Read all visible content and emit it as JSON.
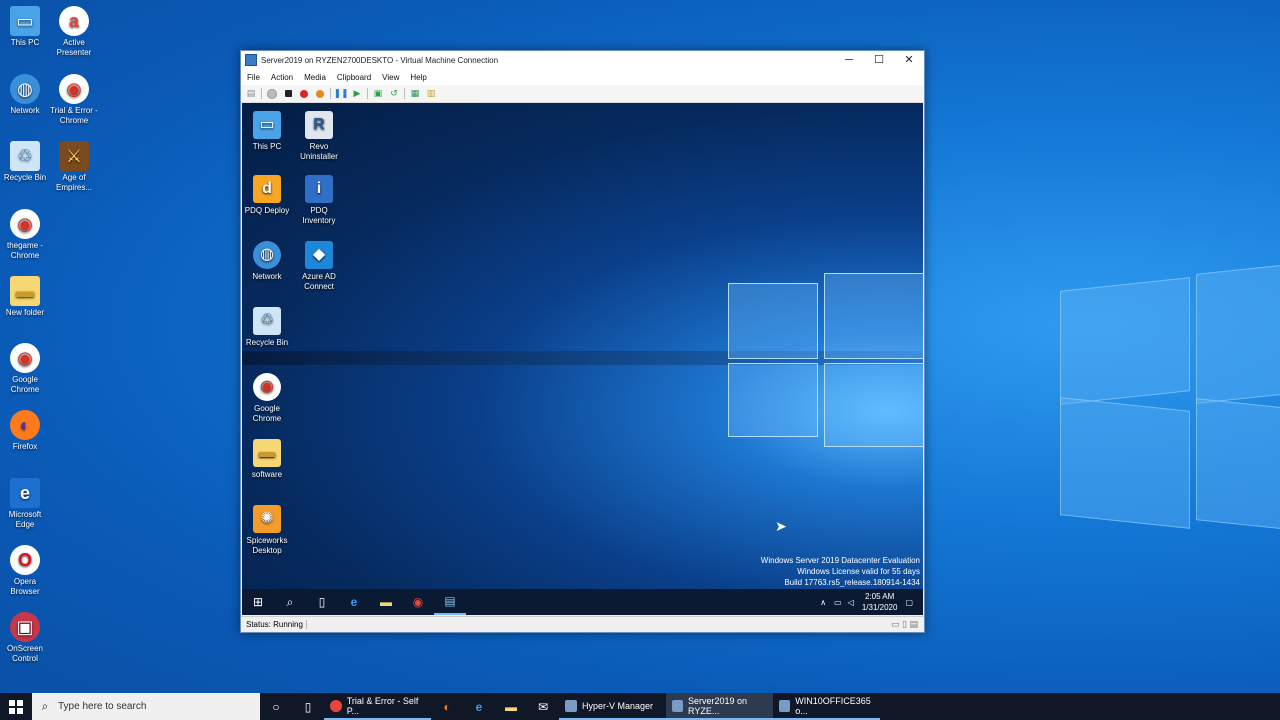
{
  "host_desktop": {
    "icons": [
      {
        "label": "This PC",
        "glyph": "▭"
      },
      {
        "label": "Active Presenter",
        "glyph": "a"
      },
      {
        "label": "Network",
        "glyph": "◍"
      },
      {
        "label": "Trial & Error - Chrome",
        "glyph": "◉"
      },
      {
        "label": "Recycle Bin",
        "glyph": "♲"
      },
      {
        "label": "Age of Empires...",
        "glyph": "⚔"
      },
      {
        "label": "thegame - Chrome",
        "glyph": "◉"
      },
      {
        "label": "New folder",
        "glyph": "▬"
      },
      {
        "label": "Google Chrome",
        "glyph": "◉"
      },
      {
        "label": "Firefox",
        "glyph": "◐"
      },
      {
        "label": "Microsoft Edge",
        "glyph": "e"
      },
      {
        "label": "Opera Browser",
        "glyph": "O"
      },
      {
        "label": "OnScreen Control",
        "glyph": "▣"
      }
    ]
  },
  "vm_window": {
    "title": "Server2019 on RYZEN2700DESKTO - Virtual Machine Connection",
    "buttons": {
      "minimize": "─",
      "maximize": "☐",
      "close": "✕"
    },
    "menu": [
      "File",
      "Action",
      "Media",
      "Clipboard",
      "View",
      "Help"
    ],
    "status": "Status: Running"
  },
  "vm_desktop": {
    "icons": [
      {
        "label": "This PC",
        "glyph": "▭"
      },
      {
        "label": "Revo Uninstaller",
        "glyph": "R"
      },
      {
        "label": "PDQ Deploy",
        "glyph": "d"
      },
      {
        "label": "PDQ Inventory",
        "glyph": "i"
      },
      {
        "label": "Network",
        "glyph": "◍"
      },
      {
        "label": "Azure AD Connect",
        "glyph": "◆"
      },
      {
        "label": "Recycle Bin",
        "glyph": "♲"
      },
      {
        "label": "Google Chrome",
        "glyph": "◉"
      },
      {
        "label": "software",
        "glyph": "▬"
      },
      {
        "label": "Spiceworks Desktop",
        "glyph": "✺"
      }
    ],
    "watermark": {
      "line1": "Windows Server 2019 Datacenter Evaluation",
      "line2": "Windows License valid for 55 days",
      "line3": "Build 17763.rs5_release.180914-1434"
    },
    "clock": {
      "time": "2:05 AM",
      "date": "1/31/2020"
    }
  },
  "host_taskbar": {
    "search_placeholder": "Type here to search",
    "apps": [
      {
        "label": "Trial & Error - Self P..."
      },
      {
        "label": "Hyper-V Manager"
      },
      {
        "label": "Server2019 on RYZE..."
      },
      {
        "label": "WIN10OFFICE365 o..."
      }
    ]
  },
  "colors": {
    "accent": "#0a5bb8",
    "taskbar": "#101827",
    "vm_taskbar": "#0b1a33"
  }
}
